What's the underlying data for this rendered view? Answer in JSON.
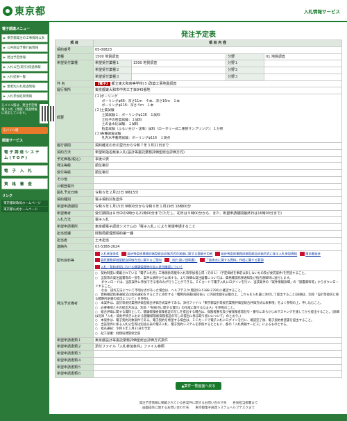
{
  "header": {
    "logo": "東京都",
    "right_title": "入札情報サービス"
  },
  "sidebar": {
    "heading1": "電子調達メニュー",
    "menu": [
      "東京都発注の工事情報公表",
      "公共施設予算計画情報",
      "発注予定情報",
      "入札公告(取引)経過情報",
      "入札結果一覧",
      "業者別入札経過情報",
      "入札参加結果情報"
    ],
    "qr_label": "モバイル版は、発注予定情報と入札（見積）経過情報に対応しています。",
    "mobile_btn": "モバイル版",
    "note": "",
    "heading2": "関連サービス",
    "big1": "電子調達システム(TOP)",
    "big2": "電 子 入 札",
    "big3": "資 格 審 査",
    "heading3": "リンク",
    "link1": "東京都財政局ホームページ",
    "link2": "東京都公式ホームページ"
  },
  "page_title": "発注予定表",
  "table": {
    "col_item": "項 目",
    "col_content": "項 目 内 容",
    "rows": [
      {
        "k": "契約番号",
        "v": "05-00823"
      },
      {
        "k": "業種",
        "v": "1500 地質調査",
        "v2": "分野",
        "v3": "01 地質調査"
      }
    ],
    "kibou": {
      "k": "希望受付業種",
      "rows": [
        {
          "label": "希望受付業種１",
          "value": "1500 地質調査",
          "bunya": "分野１"
        },
        {
          "label": "希望受付業種２",
          "value": "",
          "bunya": "分野２"
        },
        {
          "label": "希望受付業種３",
          "value": "",
          "bunya": "分野３"
        }
      ]
    },
    "kenmei_k": "件 名",
    "kenmei_tag": "【電子】",
    "kenmei_v": "都立東大和高等学校(５)改築工事地盤調査",
    "place_k": "履行場所",
    "place_v": "東京都東大和市中央三丁目945番地",
    "gaiyou_k": "概要",
    "gaiyou_v": "(１)ボーリング\n　　ボーリングφ66：深さ11ｍ　４本、深さ16ｍ　１本\n　　ボーリングφ116：深さ４ｍ　１本\n(２)土質試験\n　　土質試験１：ボーリングφ116　１試料\n　　土粒子の密度試験：１試料\n　　土の含水比試験：１試料\n　　粒度試験（ふるい分け・沈降）試料（ロータリー式二重管サンプリング）：１か所\n(３)各種調査試験\n　　孔内水平載荷試験：ボーリングφ116　１測点",
    "rest": [
      {
        "k": "履行期間",
        "v": "契約確定の日の翌日から令和７年３月21日まで"
      },
      {
        "k": "契約方法",
        "v": "希望制指名競争入札(設計等委託業務評価型総合評価方式)"
      },
      {
        "k": "予定価格(税込)",
        "v": "事後公表"
      },
      {
        "k": "発注等級",
        "v": "順位格付"
      },
      {
        "k": "受付等級",
        "v": "順位格付"
      },
      {
        "k": "その他",
        "v": ""
      },
      {
        "k": "公報登載日",
        "v": ""
      },
      {
        "k": "開札予定日時",
        "v": "令和６年２月22日 9時15分"
      },
      {
        "k": "契約種別",
        "v": "電子契約対象案件"
      },
      {
        "k": "希望申請期間",
        "v": "令和６年１月15日 9時00分から令和６年１月19日 16時00分"
      },
      {
        "k": "希望備考",
        "v": "受付期間は８日中の9時から21時00分まで(ただし、初日は９時00分から、また、希望申請期間最終日は16時00分まで)"
      },
      {
        "k": "入札方法",
        "v": "電子入札"
      },
      {
        "k": "希望申請場所",
        "v": "東京都電子調達システムの「電子入札」により希望申請すること"
      },
      {
        "k": "担当部課",
        "v": "財務局経理部契約第一課"
      },
      {
        "k": "担当者",
        "v": "土木担当"
      },
      {
        "k": "連絡先",
        "v": "03-5388-2624"
      }
    ],
    "dl_k": "配布資料等",
    "dl_items": [
      "入札参加条件",
      "設計等委託業務評価型総合評価方式の実施に関する要綱その他",
      "設計等委託業務評価型総合評価方式に係る入札参加資格",
      "東京都設計",
      "委託業務評価型総合評価方式に関するご案内",
      "（取り扱い説明書）",
      "「技術点に関する資料」作成に関する要領",
      "入札・契約手続における健康保険等の加入状況確認について"
    ],
    "note_k": "発注予定備考",
    "note_v": "○　契約制度に掲載されている「電子入札用」工事請負等競争入札等参加者心得（その１）（予定価格を事前公表しないもの及び委託案件)を熟読すること。\n○　当該等の発注図書等の一部を、案件公表時から公表する。より詳細な発注図書については、資格確認結果通知及び指名通知時に送付します。\n　　ダウンロードは、当該案件に参加できる者のみが行うことができる。ＩＣカードで電子入札にログインを行い、当該案件の「案件情報詳細」の「調書資料等」からダウンロードすること。\n　　なお、操作方法について不明な点があった場合は、ヘルプデスク(電話03-5388-2790)に確認すること。\n○　資格確認結果通知又は指名通知をするときに添付する「積算内訳書(総括表)」に内訳金額を記載の上、これらを入札書に添付して提出すること(詳細は、別添「設計等委託に係る積算内訳書の提出について」を参照)。\n○　本案件は、設計等委託業務評価型総合評価方式案件である。添付ファイル「東京都設計等委託業務評価型総合評価方式公表事項」をよく参照の上、申し込むこと。\n○　必要事項とその提出方法は、別添「「技術点に関する資料」の作成に関するＱ＆Ａ」を参照のこと。\n○　総合評価に関する資料として、健康保険被保険者証の写しを提出する場合は、保険者番号及び被保険者等記号・番号にあらかじめマスキングを施してから提出すること。(詳細は別添「入札・契約手続きにおける健康保険被保険者証の写しの提出に係る取り扱いについて」のとおり。)\n○　本案件は、電子契約対象案件である。電子契約を希望する場合は、ＩＣカードで電子入札にログインを行い、確認完了後、電子契約希望書を提出すること。\n○　当該案件に係る入札公告等は別途公表の電子入札、電子契約システムを参照するとともに、都の「入札情報サービス」によるものとする。\n○　指名通知：令和６年１月31日の予定\n○　起工部署：財務局建築保全部",
    "tail": [
      {
        "k": "希望申請書類１",
        "v": "東京都設計等委託業務評価型総合評価方式案件"
      },
      {
        "k": "希望申請書類２",
        "v": "添付ファイル「入札参加条件」ファイル参照"
      },
      {
        "k": "希望申請書類３",
        "v": ""
      },
      {
        "k": "希望申請書類４",
        "v": ""
      },
      {
        "k": "希望申請書類５",
        "v": ""
      },
      {
        "k": "希望申請書類６",
        "v": ""
      }
    ]
  },
  "back_btn": "▲案件一覧画面へ戻る",
  "footer": {
    "line1": "発注予定情報に掲載されている各案件に関するお問い合わせ先　　各局担当部署まで",
    "line2": "画面操作に関するお問い合わせ先　　東京都電子調達システムヘルプデスクまで"
  }
}
